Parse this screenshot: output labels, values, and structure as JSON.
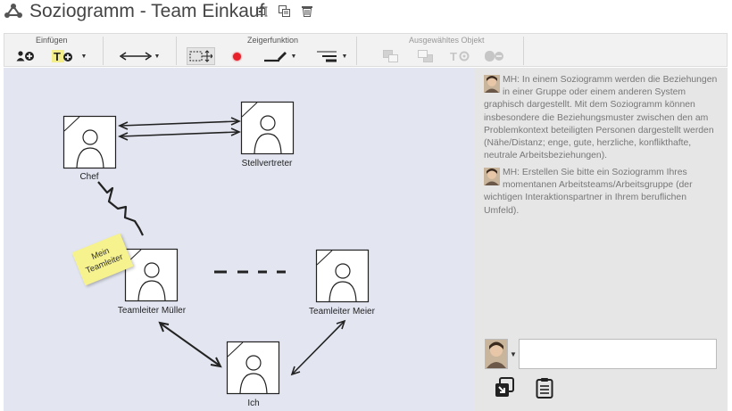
{
  "window": {
    "title": "Soziogramm - Team Einkauf",
    "title_actions": [
      "edit-title-icon",
      "copy-icon",
      "delete-icon"
    ]
  },
  "toolbar": {
    "groups": {
      "insert": "Einfügen",
      "pointer": "Zeigerfunktion",
      "selected": "Ausgewähltes Objekt"
    },
    "buttons": {
      "add_person": "add-person-icon",
      "add_text": "add-text-icon",
      "arrow_style": "arrow-style-icon",
      "select_move": "select-move-icon",
      "color": "#e8202a",
      "pen": "pen-icon",
      "line_style": "line-style-icon"
    }
  },
  "canvas": {
    "nodes": [
      {
        "id": "chef",
        "label": "Chef"
      },
      {
        "id": "stellvertreter",
        "label": "Stellvertreter"
      },
      {
        "id": "mueller",
        "label": "Teamleiter Müller"
      },
      {
        "id": "meier",
        "label": "Teamleiter Meier"
      },
      {
        "id": "ich",
        "label": "Ich"
      }
    ],
    "sticky_note": "Mein Teamleiter",
    "edges": [
      {
        "from": "chef",
        "to": "stellvertreter",
        "type": "double-bidirectional"
      },
      {
        "from": "chef",
        "to": "mueller",
        "type": "conflict"
      },
      {
        "from": "mueller",
        "to": "meier",
        "type": "dashed"
      },
      {
        "from": "mueller",
        "to": "ich",
        "type": "bidirectional"
      },
      {
        "from": "ich",
        "to": "meier",
        "type": "bidirectional"
      }
    ]
  },
  "panel": {
    "messages": [
      {
        "author": "MH",
        "text": "MH: In einem Soziogramm werden die Beziehungen in einer Gruppe oder einem anderen System graphisch dargestellt. Mit dem Soziogramm können insbesondere die Beziehungsmuster zwischen den am Problemkontext beteiligten Personen dargestellt werden (Nähe/Distanz; enge, gute, herzliche, konflikthafte, neutrale Arbeitsbeziehungen)."
      },
      {
        "author": "MH",
        "text": "MH: Erstellen Sie bitte ein Soziogramm Ihres momentanen Arbeitsteams/Arbeitsgruppe (der wichtigen Interaktionspartner in Ihrem beruflichen Umfeld)."
      }
    ],
    "composer": {
      "value": "",
      "placeholder": ""
    },
    "actions": [
      "import-icon",
      "clipboard-icon"
    ]
  }
}
